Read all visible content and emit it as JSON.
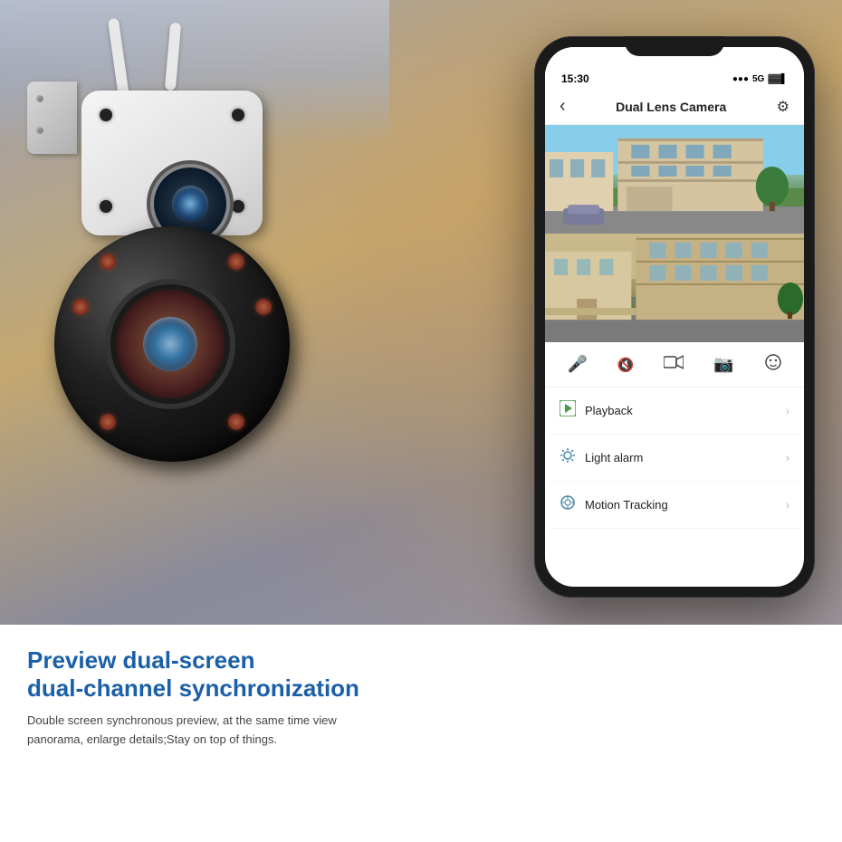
{
  "page": {
    "bg_top_color": "#c0bfca",
    "bg_bottom_color": "#ffffff"
  },
  "phone": {
    "status_time": "15:30",
    "status_signal": "5G",
    "app_title": "Dual Lens Camera",
    "back_icon": "‹",
    "settings_icon": "⚙",
    "controls": [
      {
        "icon": "🎤",
        "label": "microphone"
      },
      {
        "icon": "🔇",
        "label": "mute"
      },
      {
        "icon": "⬛",
        "label": "record"
      },
      {
        "icon": "📷",
        "label": "snapshot"
      },
      {
        "icon": "😊",
        "label": "face"
      }
    ],
    "menu_items": [
      {
        "icon": "▶",
        "label": "Playback",
        "chevron": "›"
      },
      {
        "icon": "🔔",
        "label": "Light alarm",
        "chevron": "›"
      },
      {
        "icon": "🎯",
        "label": "Motion Tracking",
        "chevron": "›"
      }
    ]
  },
  "bottom": {
    "headline_line1": "Preview dual-screen",
    "headline_line2": "dual-channel synchronization",
    "subtext": "Double screen synchronous preview, at the same time view panorama, enlarge details;Stay on top of things."
  },
  "camera": {
    "description": "Dual Lens PTZ Security Camera",
    "color_white": "#f0f0f0",
    "color_black": "#111111"
  }
}
